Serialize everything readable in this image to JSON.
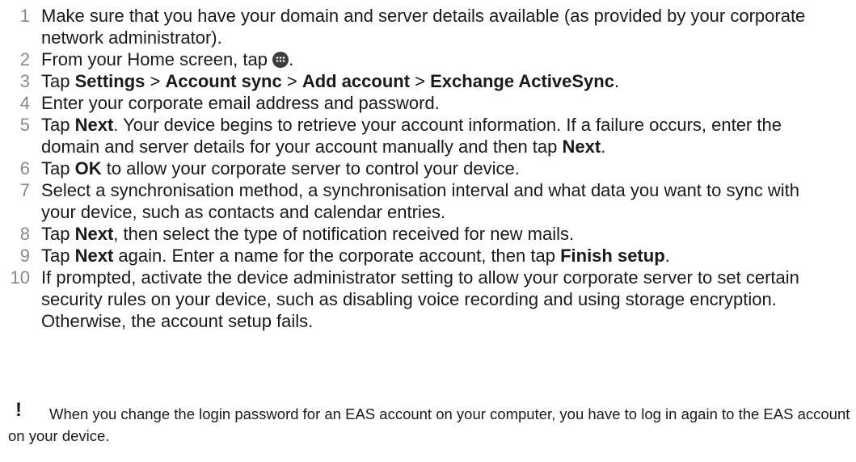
{
  "steps": [
    {
      "num": "1",
      "segments": [
        {
          "t": "Make sure that you have your domain and server details available (as provided by your corporate network administrator).",
          "b": false
        }
      ]
    },
    {
      "num": "2",
      "segments": [
        {
          "t": "From your Home screen, tap ",
          "b": false
        },
        {
          "icon": "apps-icon"
        },
        {
          "t": ".",
          "b": false
        }
      ]
    },
    {
      "num": "3",
      "segments": [
        {
          "t": "Tap ",
          "b": false
        },
        {
          "t": "Settings",
          "b": true
        },
        {
          "t": " > ",
          "b": false
        },
        {
          "t": "Account sync",
          "b": true
        },
        {
          "t": " > ",
          "b": false
        },
        {
          "t": "Add account",
          "b": true
        },
        {
          "t": " > ",
          "b": false
        },
        {
          "t": "Exchange ActiveSync",
          "b": true
        },
        {
          "t": ".",
          "b": false
        }
      ]
    },
    {
      "num": "4",
      "segments": [
        {
          "t": "Enter your corporate email address and password.",
          "b": false
        }
      ]
    },
    {
      "num": "5",
      "segments": [
        {
          "t": "Tap ",
          "b": false
        },
        {
          "t": "Next",
          "b": true
        },
        {
          "t": ". Your device begins to retrieve your account information. If a failure occurs, enter the domain and server details for your account manually and then tap ",
          "b": false
        },
        {
          "t": "Next",
          "b": true
        },
        {
          "t": ".",
          "b": false
        }
      ]
    },
    {
      "num": "6",
      "segments": [
        {
          "t": "Tap ",
          "b": false
        },
        {
          "t": "OK",
          "b": true
        },
        {
          "t": " to allow your corporate server to control your device.",
          "b": false
        }
      ]
    },
    {
      "num": "7",
      "segments": [
        {
          "t": "Select a synchronisation method, a synchronisation interval and what data you want to sync with your device, such as contacts and calendar entries.",
          "b": false
        }
      ]
    },
    {
      "num": "8",
      "segments": [
        {
          "t": "Tap ",
          "b": false
        },
        {
          "t": "Next",
          "b": true
        },
        {
          "t": ", then select the type of notification received for new mails.",
          "b": false
        }
      ]
    },
    {
      "num": "9",
      "segments": [
        {
          "t": "Tap ",
          "b": false
        },
        {
          "t": "Next",
          "b": true
        },
        {
          "t": " again. Enter a name for the corporate account, then tap ",
          "b": false
        },
        {
          "t": "Finish setup",
          "b": true
        },
        {
          "t": ".",
          "b": false
        }
      ]
    },
    {
      "num": "10",
      "segments": [
        {
          "t": "If prompted, activate the device administrator setting to allow your corporate server to set certain security rules on your device, such as disabling voice recording and using storage encryption. Otherwise, the account setup fails.",
          "b": false
        }
      ]
    }
  ],
  "note": {
    "icon": "exclamation-icon",
    "mark": "!",
    "text": "When you change the login password for an EAS account on your computer, you have to log in again to the EAS account on your device."
  }
}
